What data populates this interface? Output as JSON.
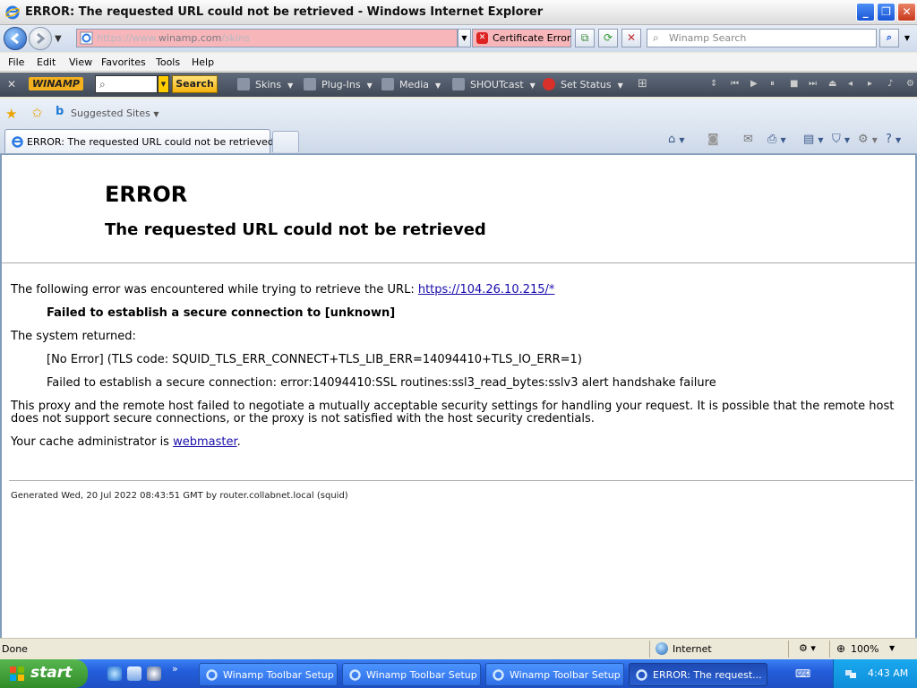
{
  "window": {
    "title": "ERROR: The requested URL could not be retrieved - Windows Internet Explorer",
    "minimize": "_",
    "restore": "❐",
    "close": "✕"
  },
  "address": {
    "url_prefix": "https://www.",
    "url_domain": "winamp.com",
    "url_path": "/skins",
    "certificate_error": "Certificate Error",
    "search_placeholder": "Winamp Search"
  },
  "menu": [
    "File",
    "Edit",
    "View",
    "Favorites",
    "Tools",
    "Help"
  ],
  "winamp": {
    "logo": "WINAMP",
    "search_button": "Search",
    "skins": "Skins",
    "plugins": "Plug-Ins",
    "media": "Media",
    "shoutcast": "SHOUTcast",
    "set_status": "Set Status"
  },
  "favorites": {
    "suggested_sites": "Suggested Sites"
  },
  "tab": {
    "title": "ERROR: The requested URL could not be retrieved"
  },
  "page": {
    "heading": "ERROR",
    "subheading": "The requested URL could not be retrieved",
    "intro_text": "The following error was encountered while trying to retrieve the URL: ",
    "intro_link": "https://104.26.10.215/*",
    "failed_bold": "Failed to establish a secure connection to [unknown]",
    "system_returned": "The system returned:",
    "no_error": "[No Error] (TLS code: SQUID_TLS_ERR_CONNECT+TLS_LIB_ERR=14094410+TLS_IO_ERR=1)",
    "ssl_detail": "Failed to establish a secure connection: error:14094410:SSL routines:ssl3_read_bytes:sslv3 alert handshake failure",
    "proxy_text": "This proxy and the remote host failed to negotiate a mutually acceptable security settings for handling your request. It is possible that the remote host does not support secure connections, or the proxy is not satisfied with the host security credentials.",
    "cache_admin_text": "Your cache administrator is ",
    "cache_admin_link": "webmaster",
    "cache_admin_end": ".",
    "generated": "Generated Wed, 20 Jul 2022 08:43:51 GMT by router.collabnet.local (squid)"
  },
  "status": {
    "text": "Done",
    "zone": "Internet",
    "zoom": "100%"
  },
  "taskbar": {
    "start": "start",
    "buttons": [
      "Winamp Toolbar Setup",
      "Winamp Toolbar Setup",
      "Winamp Toolbar Setup",
      "ERROR: The request..."
    ],
    "clock": "4:43 AM"
  },
  "colors": {
    "address_error_bg": "#f7b6b9",
    "link": "#1a0dab",
    "winamp_search_button": "#f5b20d"
  }
}
